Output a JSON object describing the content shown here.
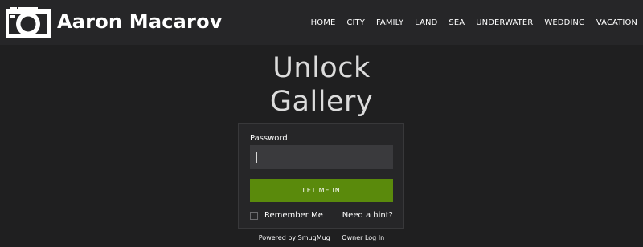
{
  "header": {
    "logo_icon": "camera-icon",
    "site_name": "Aaron Macarov",
    "nav": [
      "HOME",
      "CITY",
      "FAMILY",
      "LAND",
      "SEA",
      "UNDERWATER",
      "WEDDING",
      "VACATION"
    ]
  },
  "main": {
    "title_line1": "Unlock",
    "title_line2": "Gallery",
    "password_label": "Password",
    "password_value": "",
    "submit_label": "LET ME IN",
    "remember_label": "Remember Me",
    "remember_checked": false,
    "hint_link": "Need a hint?"
  },
  "footer": {
    "powered_by": "Powered by SmugMug",
    "owner_login": "Owner Log In"
  },
  "colors": {
    "background": "#1f1f20",
    "header": "#262628",
    "button": "#5a8a0c",
    "input": "#3a3a3d"
  }
}
